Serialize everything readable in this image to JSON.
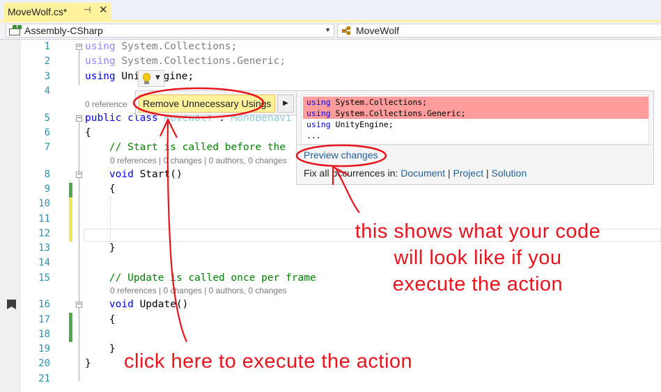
{
  "tab": {
    "title": "MoveWolf.cs*",
    "pin_glyph": "⊣",
    "close_glyph": "✕"
  },
  "navbar": {
    "project": "Assembly-CSharp",
    "member": "MoveWolf"
  },
  "editor": {
    "lines": [
      "1",
      "2",
      "3",
      "4",
      "5",
      "6",
      "7",
      "8",
      "9",
      "10",
      "11",
      "12",
      "13",
      "14",
      "15",
      "16",
      "17",
      "18",
      "19",
      "20",
      "21"
    ],
    "code": {
      "l1_kw": "using",
      "l1_rest": " System.Collections;",
      "l2_kw": "using",
      "l2_rest": " System.Collections.Generic;",
      "l3_kw": "using",
      "l3_a": " Uni",
      "l3_b": "gine;",
      "lens_class": "0 reference",
      "l5_a": "public",
      "l5_b": " class",
      "l5_c": " MoveWolf",
      "l5_d": " : ",
      "l5_e": "MonoBehavi",
      "l6": "{",
      "l7": "    // Start is called before the",
      "lens_start": "0 references | 0 changes | 0 authors, 0 changes",
      "l8_kw": "    void",
      "l8_rest": " Start()",
      "l9": "    {",
      "l13": "    }",
      "l15": "    // Update is called once per frame",
      "lens_update": "0 references | 0 changes | 0 authors, 0 changes",
      "l16_kw": "    void",
      "l16_rest": " Update()",
      "l17": "    {",
      "l19": "    }",
      "l20": "}"
    }
  },
  "quick_actions": {
    "item": "Remove Unnecessary Usings",
    "submenu_glyph": "▶"
  },
  "preview": {
    "removed_1_kw": "using",
    "removed_1_rest": " System.Collections;",
    "removed_2_kw": "using",
    "removed_2_rest": " System.Collections.Generic;",
    "kept_kw": "using",
    "kept_rest": " UnityEngine;",
    "ellipsis": "...",
    "preview_link": "Preview changes",
    "fix_all_label": "Fix all occurrences in: ",
    "fix_document": "Document",
    "fix_project": "Project",
    "fix_solution": "Solution",
    "sep": " | "
  },
  "annotations": {
    "preview_note_1": "this shows what your code",
    "preview_note_2": "will look like if you",
    "preview_note_3": "execute the action",
    "click_note": "click here to execute the action",
    "color": "#e8141e"
  }
}
